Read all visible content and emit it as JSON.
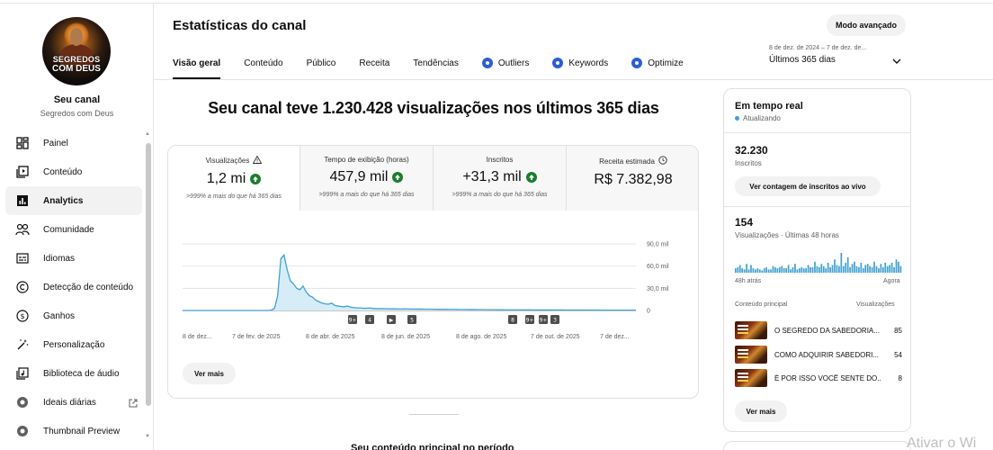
{
  "channel": {
    "avatar_text_line1": "SEGREDOS",
    "avatar_text_line2": "COM DEUS",
    "label": "Seu canal",
    "name": "Segredos com Deus"
  },
  "sidebar": {
    "items": [
      {
        "label": "Painel",
        "icon": "dashboard-icon"
      },
      {
        "label": "Conteúdo",
        "icon": "content-icon"
      },
      {
        "label": "Analytics",
        "icon": "analytics-icon",
        "active": true
      },
      {
        "label": "Comunidade",
        "icon": "community-icon"
      },
      {
        "label": "Idiomas",
        "icon": "subtitles-icon"
      },
      {
        "label": "Detecção de conteúdo",
        "icon": "copyright-icon"
      },
      {
        "label": "Ganhos",
        "icon": "earn-icon"
      },
      {
        "label": "Personalização",
        "icon": "magic-wand-icon"
      },
      {
        "label": "Biblioteca de áudio",
        "icon": "audio-library-icon"
      },
      {
        "label": "Ideais diárias",
        "icon": "extension-icon",
        "external": true
      },
      {
        "label": "Thumbnail Preview",
        "icon": "extension-icon"
      }
    ]
  },
  "header": {
    "title": "Estatísticas do canal",
    "mode_button": "Modo avançado",
    "tabs": [
      {
        "label": "Visão geral",
        "active": true
      },
      {
        "label": "Conteúdo"
      },
      {
        "label": "Público"
      },
      {
        "label": "Receita"
      },
      {
        "label": "Tendências"
      },
      {
        "label": "Outliers",
        "ext_icon": true
      },
      {
        "label": "Keywords",
        "ext_icon": true
      },
      {
        "label": "Optimize",
        "ext_icon": true
      }
    ],
    "date_range_detail": "8 de dez. de 2024 – 7 de dez. de...",
    "date_range_label": "Últimos 365 dias"
  },
  "overview": {
    "headline": "Seu canal teve 1.230.428 visualizações nos últimos 365 dias",
    "metrics": [
      {
        "label": "Visualizações",
        "value": "1,2 mi",
        "note": ">999% a mais do que há 365 dias",
        "trend": "up",
        "icon": "warning-icon"
      },
      {
        "label": "Tempo de exibição (horas)",
        "value": "457,9 mil",
        "note": ">999% a mais do que há 365 dias",
        "trend": "up"
      },
      {
        "label": "Inscritos",
        "value": "+31,3 mil",
        "note": ">999% a mais do que há 365 dias",
        "trend": "up"
      },
      {
        "label": "Receita estimada",
        "value": "R$ 7.382,98",
        "note": "",
        "icon": "clock-icon"
      }
    ],
    "more_button": "Ver mais"
  },
  "chart_data": {
    "type": "area",
    "x_tick_labels": [
      "8 de dez...",
      "7 de fev. de 2025",
      "8 de abr. de 2025",
      "8 de jun. de 2025",
      "8 de ago. de 2025",
      "7 de out. de 2025",
      "7 de dez..."
    ],
    "y_tick_labels": [
      "90,0 mil",
      "60,0 mil",
      "30,0 mil",
      "0"
    ],
    "ylim": [
      0,
      90000
    ],
    "series": [
      {
        "values": [
          0,
          0,
          0,
          0,
          0,
          0,
          0,
          0,
          0,
          0,
          0,
          0,
          0,
          0,
          0,
          0,
          0,
          0,
          0,
          0,
          0,
          0,
          0,
          0,
          0,
          0,
          0,
          0,
          500,
          3000,
          20000,
          70000,
          75000,
          55000,
          40000,
          36000,
          30000,
          28000,
          33000,
          25000,
          20000,
          18000,
          14000,
          12000,
          10000,
          9000,
          8500,
          10000,
          7000,
          6000,
          5500,
          5000,
          6000,
          4500,
          4000,
          3500,
          3500,
          3000,
          3000,
          3500,
          2800,
          2500,
          2500,
          2600,
          2400,
          2200,
          2300,
          2200,
          2100,
          2000,
          2200,
          2100,
          2000,
          2000,
          1900,
          1900,
          1800,
          1800,
          1800,
          1700,
          1700,
          1600,
          1600,
          1600,
          1500,
          1500,
          1500,
          1400,
          1400,
          1400,
          1300,
          1300,
          1300,
          1200,
          1200,
          1200,
          1100,
          1100,
          1100,
          1000,
          1000,
          1000,
          950,
          950,
          900,
          900,
          900,
          850,
          850,
          850,
          800,
          800,
          800,
          800,
          750,
          750,
          750,
          700,
          700,
          700,
          700,
          650,
          650,
          650,
          600,
          600,
          600,
          600,
          550,
          550,
          550,
          550,
          500,
          500,
          500,
          500,
          500,
          500,
          500,
          500,
          500,
          500,
          500,
          500
        ]
      }
    ],
    "markers": [
      "9+",
      "4",
      "▶",
      "5",
      "8",
      "9+",
      "9+",
      "3"
    ],
    "color": "#41a1d0"
  },
  "realtime": {
    "title": "Em tempo real",
    "status": "Atualizando",
    "subscribers_value": "32.230",
    "subscribers_label": "Inscritos",
    "live_count_button": "Ver contagem de inscritos ao vivo",
    "views_value": "154",
    "views_label": "Visualizações · Últimas 48 horas",
    "bars": [
      4,
      5,
      7,
      4,
      3,
      8,
      3,
      7,
      4,
      3,
      4,
      3,
      2,
      4,
      5,
      3,
      3,
      6,
      5,
      4,
      5,
      6,
      4,
      4,
      7,
      3,
      5,
      8,
      3,
      4,
      5,
      4,
      4,
      7,
      5,
      5,
      10,
      6,
      5,
      8,
      6,
      4,
      9,
      5,
      7,
      12,
      7,
      6,
      18,
      6,
      9,
      14,
      5,
      8,
      10,
      6,
      5,
      9,
      4,
      7,
      8,
      6,
      5,
      10,
      6,
      4,
      8,
      5,
      9,
      6,
      7,
      9,
      5,
      12,
      10,
      6
    ],
    "x_start": "48h atrás",
    "x_end": "Agora",
    "col_content": "Conteúdo principal",
    "col_views": "Visualizações",
    "videos": [
      {
        "title": "O SEGREDO DA SABEDORIA...",
        "views": "85"
      },
      {
        "title": "COMO ADQUIRIR SABEDORI...",
        "views": "54"
      },
      {
        "title": "É POR ISSO VOCÊ SENTE DO...",
        "views": "8"
      }
    ],
    "more_button": "Ver mais"
  },
  "bottom_section_title": "Seu conteúdo principal no período",
  "watermark": "Ativar o Wi"
}
